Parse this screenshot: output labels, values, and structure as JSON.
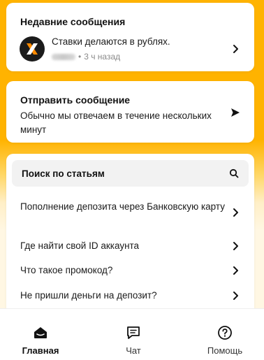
{
  "recent": {
    "title": "Недавние сообщения",
    "message": "Ставки делаются в рублях.",
    "meta_separator": "•",
    "time_ago": "3 ч назад"
  },
  "send": {
    "title": "Отправить сообщение",
    "description": "Обычно мы отвечаем в течение нескольких минут"
  },
  "articles": {
    "search_label": "Поиск по статьям",
    "items": [
      {
        "label": "Пополнение депозита через Банковскую карту"
      },
      {
        "label": "Где найти свой ID аккаунта"
      },
      {
        "label": "Что такое промокод?"
      },
      {
        "label": "Не пришли деньги на депозит?"
      }
    ]
  },
  "nav": {
    "home": "Главная",
    "chat": "Чат",
    "help": "Помощь"
  },
  "colors": {
    "accent": "#FFB300",
    "logo_orange": "#FF8A00"
  }
}
